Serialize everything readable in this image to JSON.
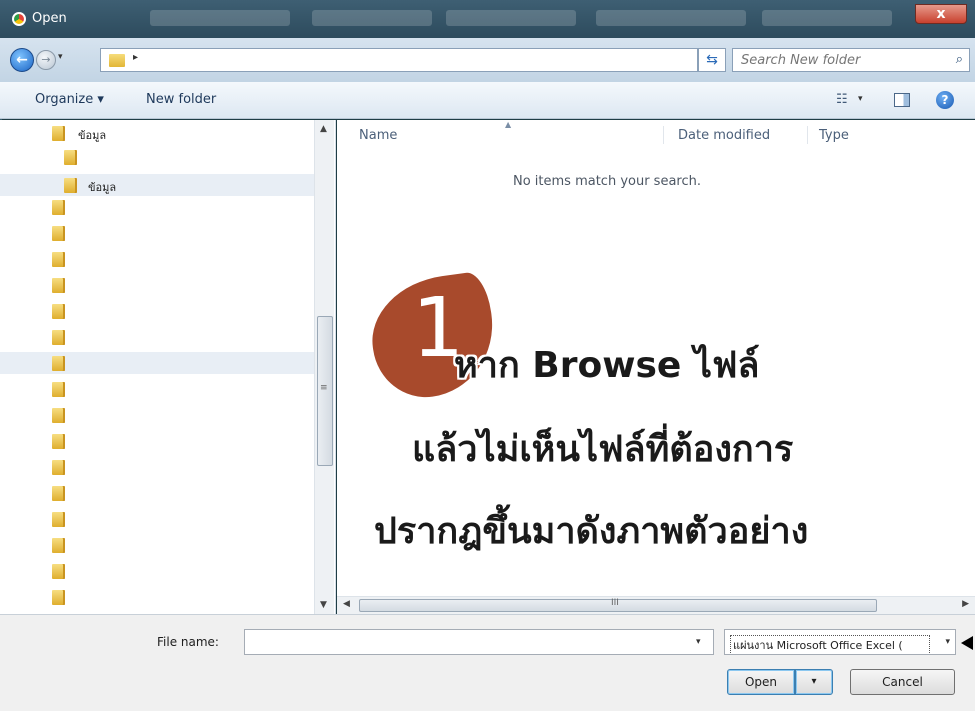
{
  "window": {
    "title": "Open",
    "close_label": "x"
  },
  "address_bar": {
    "back_glyph": "←",
    "forward_glyph": "→",
    "path_arrow": "▸",
    "dropdown_glyph": "▾",
    "refresh_glyph": "⇆"
  },
  "search": {
    "placeholder": "Search New folder",
    "icon_glyph": "⌕"
  },
  "toolbar": {
    "organize_label": "Organize ▾",
    "new_folder_label": "New folder",
    "view_glyph": "☷",
    "dropdown_glyph": "▾",
    "help_glyph": "?"
  },
  "nav_pane": {
    "items": [
      {
        "label": "ข้อมูล"
      },
      {
        "label": ""
      },
      {
        "label": "ข้อมูล"
      }
    ],
    "scroll_up": "▲",
    "scroll_down": "▼",
    "grip": "≡"
  },
  "file_list": {
    "columns": [
      "Name",
      "Date modified",
      "Type"
    ],
    "empty_message": "No items match your search.",
    "sort_glyph": "▲",
    "scroll_left": "◀",
    "scroll_right": "▶",
    "grip": "III"
  },
  "bottom": {
    "file_name_label": "File name:",
    "file_name_value": "",
    "file_type_value": "แผ่นงาน Microsoft Office Excel (",
    "dropdown_glyph": "▾",
    "open_label": "Open",
    "open_drop_glyph": "▾",
    "cancel_label": "Cancel"
  },
  "overlay": {
    "step_number": "1",
    "line1": "หาก Browse ไฟล์",
    "line2": "แล้วไม่เห็นไฟล์ที่ต้องการ",
    "line3": "ปรากฎขึ้นมาดังภาพตัวอย่าง",
    "badge_color": "#a84a2c"
  }
}
